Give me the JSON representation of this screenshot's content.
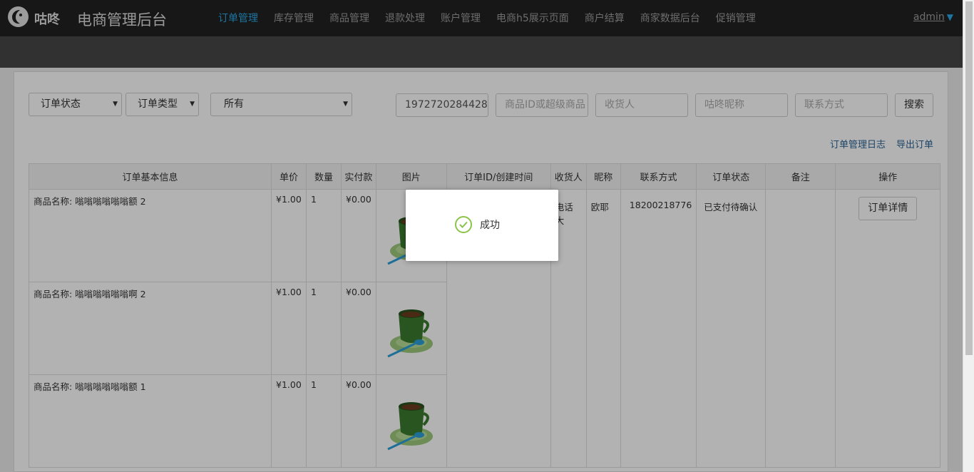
{
  "header": {
    "brand": "咕咚",
    "title": "电商管理后台",
    "nav": [
      {
        "label": "订单管理",
        "active": true
      },
      {
        "label": "库存管理"
      },
      {
        "label": "商品管理"
      },
      {
        "label": "退款处理"
      },
      {
        "label": "账户管理"
      },
      {
        "label": "电商h5展示页面"
      },
      {
        "label": "商户结算"
      },
      {
        "label": "商家数据后台"
      },
      {
        "label": "促销管理"
      }
    ],
    "user": "admin",
    "user_caret": "▼"
  },
  "filters": {
    "order_status": "订单状态",
    "order_type": "订单类型",
    "scope": "所有",
    "select_arrow": "▼",
    "order_id_value": "1972720284428",
    "product_placeholder": "商品ID或超级商品",
    "receiver_placeholder": "收货人",
    "nickname_placeholder": "咕咚昵称",
    "contact_placeholder": "联系方式",
    "search_label": "搜索"
  },
  "links": {
    "log": "订单管理日志",
    "export": "导出订单"
  },
  "table": {
    "headers": [
      "订单基本信息",
      "单价",
      "数量",
      "实付款",
      "图片",
      "订单ID/创建时间",
      "收货人",
      "昵称",
      "联系方式",
      "订单状态",
      "备注",
      "操作"
    ],
    "rows": [
      {
        "name": "商品名称: 嗡嗡嗡嗡嗡嗡额 2",
        "price": "¥1.00",
        "qty": "1",
        "paid": "¥0.00"
      },
      {
        "name": "商品名称: 嗡嗡嗡嗡嗡嗡啊 2",
        "price": "¥1.00",
        "qty": "1",
        "paid": "¥0.00"
      },
      {
        "name": "商品名称: 嗡嗡嗡嗡嗡嗡额 1",
        "price": "¥1.00",
        "qty": "1",
        "paid": "¥0.00"
      }
    ],
    "order": {
      "receiver": "电话大",
      "nickname": "欧耶",
      "contact": "18200218776",
      "status": "已支付待确认",
      "detail_label": "订单详情"
    }
  },
  "toast": {
    "message": "成功",
    "icon": "check-circle-icon"
  },
  "colors": {
    "accent": "#2aa8e8",
    "topbar": "#222222",
    "success": "#8bc34a"
  }
}
